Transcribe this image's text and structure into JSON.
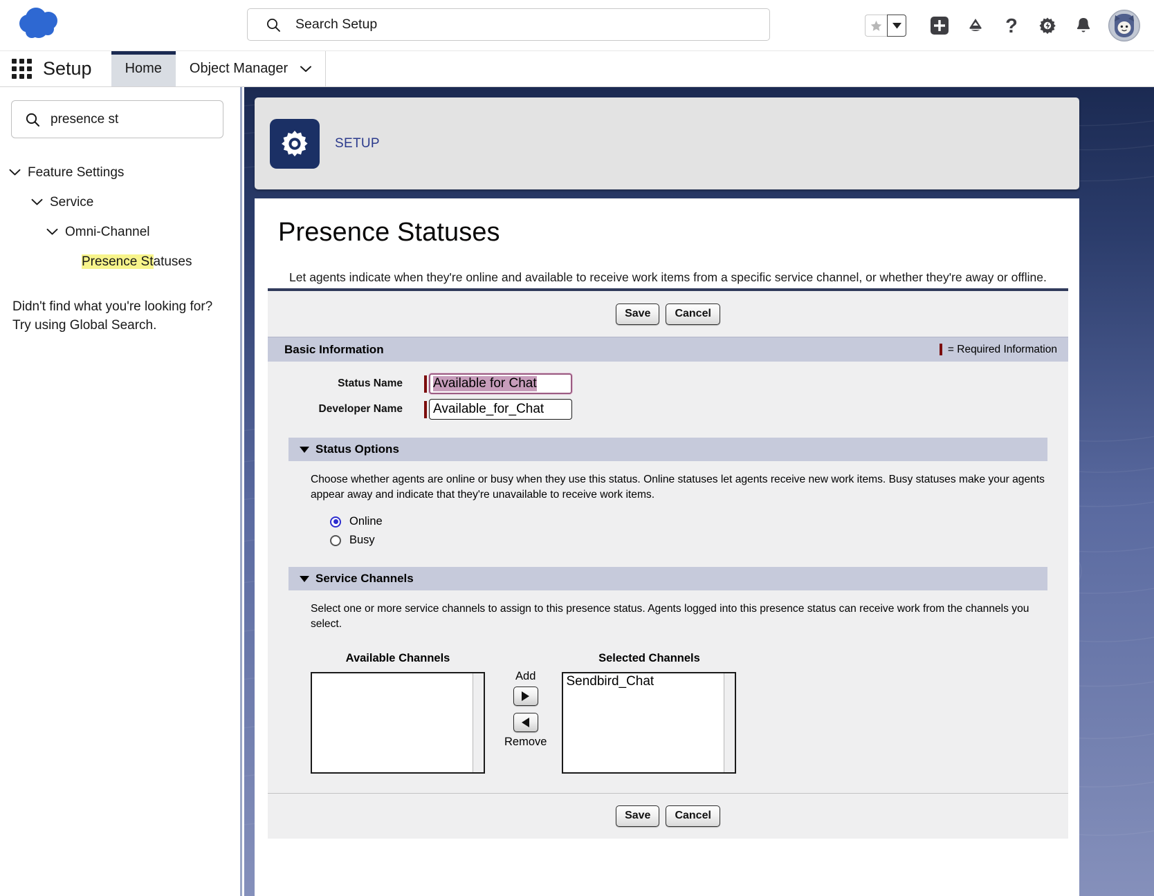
{
  "header": {
    "logo_icon": "salesforce-cloud-logo",
    "search": {
      "placeholder": "Search Setup",
      "value": "",
      "display": "Search Setup",
      "icon": "search-icon"
    },
    "actions": [
      {
        "name": "favorites-star",
        "icon": "star-icon"
      },
      {
        "name": "favorites-dropdown",
        "icon": "chevron-down-icon"
      },
      {
        "name": "global-create",
        "icon": "plus-icon"
      },
      {
        "name": "learning-trailhead",
        "icon": "trailhead-icon"
      },
      {
        "name": "help",
        "icon": "question-mark-icon"
      },
      {
        "name": "setup",
        "icon": "gear-icon"
      },
      {
        "name": "notifications",
        "icon": "bell-icon"
      },
      {
        "name": "user-avatar",
        "icon": "avatar-icon"
      }
    ]
  },
  "setup_nav": {
    "app_launcher_icon": "app-launcher-waffle-icon",
    "app_name": "Setup",
    "tabs": [
      {
        "label": "Home",
        "active": true
      },
      {
        "label": "Object Manager",
        "active": false,
        "has_caret": true
      }
    ]
  },
  "sidebar": {
    "search": {
      "value": "presence st",
      "placeholder": "Quick Find",
      "icon": "search-icon"
    },
    "tree": [
      {
        "label": "Feature Settings",
        "level": 0,
        "expanded": true
      },
      {
        "label": "Service",
        "level": 1,
        "expanded": true
      },
      {
        "label": "Omni-Channel",
        "level": 2,
        "expanded": true
      },
      {
        "label": "Presence Statuses",
        "level": 3,
        "expanded": false,
        "highlight_prefix": "Presence St",
        "highlight_rest": "atuses",
        "selected": true
      }
    ],
    "note_line1": "Didn't find what you're looking for?",
    "note_line2": "Try using Global Search."
  },
  "setup_card": {
    "icon": "gear-icon",
    "label": "SETUP"
  },
  "page": {
    "title": "Presence Statuses",
    "description": "Let agents indicate when they're online and available to receive work items from a specific service channel, or whether they're away or offline."
  },
  "form": {
    "top_buttons": [
      {
        "label": "Save",
        "name": "save-button-top"
      },
      {
        "label": "Cancel",
        "name": "cancel-button-top"
      }
    ],
    "bottom_buttons": [
      {
        "label": "Save",
        "name": "save-button-bottom"
      },
      {
        "label": "Cancel",
        "name": "cancel-button-bottom"
      }
    ],
    "basic_information": {
      "section_title": "Basic Information",
      "required_legend": "= Required Information",
      "fields": [
        {
          "label": "Status Name",
          "value": "Available for Chat",
          "required": true,
          "focused": true,
          "selected_text": true
        },
        {
          "label": "Developer Name",
          "value": "Available_for_Chat",
          "required": true,
          "focused": false,
          "selected_text": false
        }
      ]
    },
    "status_options": {
      "section_title": "Status Options",
      "description": "Choose whether agents are online or busy when they use this status. Online statuses let agents receive new work items. Busy statuses make your agents appear away and indicate that they're unavailable to receive work items.",
      "radios": [
        {
          "label": "Online",
          "checked": true
        },
        {
          "label": "Busy",
          "checked": false
        }
      ]
    },
    "service_channels": {
      "section_title": "Service Channels",
      "description": "Select one or more service channels to assign to this presence status. Agents logged into this presence status can receive work from the channels you select.",
      "available_label": "Available Channels",
      "selected_label": "Selected Channels",
      "available_items": [],
      "selected_items": [
        "Sendbird_Chat"
      ],
      "add_label": "Add",
      "remove_label": "Remove"
    }
  },
  "colors": {
    "brand_navy": "#1b3065",
    "accent_blue": "#2b3a8c",
    "required_red": "#7c0c0c",
    "section_bar": "#c6cadb",
    "selection_pink": "#c79dbb",
    "highlight_yellow": "#f7f48b",
    "radio_blue": "#2d2dcf"
  }
}
